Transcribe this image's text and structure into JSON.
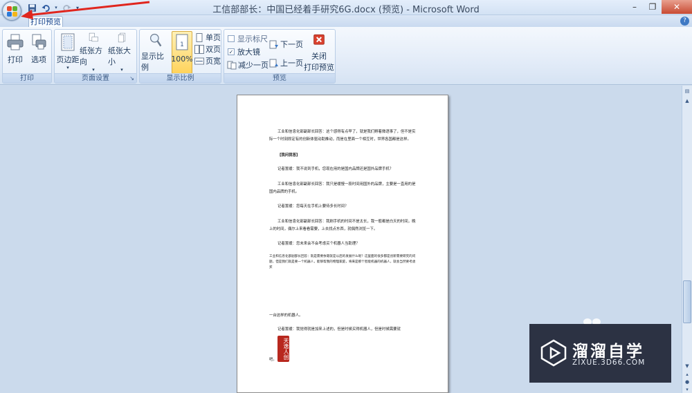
{
  "window": {
    "title": "工信部部长：中国已经着手研究6G.docx (预览) - Microsoft Word",
    "controls": {
      "minimize": "–",
      "restore": "❐",
      "close": "✕"
    }
  },
  "quick_access": {
    "save_icon": "save-icon",
    "undo_icon": "undo-icon",
    "redo_icon": "redo-icon",
    "customize": "▾"
  },
  "tabs": {
    "active_label": "打印预览"
  },
  "help": "?",
  "ribbon": {
    "groups": {
      "print": {
        "label": "打印",
        "print_label": "打印",
        "options_label": "选项"
      },
      "page_setup": {
        "label": "页面设置",
        "margins_label": "页边距",
        "orientation_label": "纸张方向",
        "size_label": "纸张大小"
      },
      "zoom": {
        "label": "显示比例",
        "zoom_label": "显示比例",
        "percent_label": "100%",
        "one_page": "单页",
        "two_pages": "双页",
        "page_width": "页宽"
      },
      "preview": {
        "label": "预览",
        "show_ruler": "显示标尺",
        "magnifier": "放大镜",
        "shrink_one_page": "减少一页",
        "next_page": "下一页",
        "prev_page": "上一页",
        "close_label_1": "关闭",
        "close_label_2": "打印预览"
      }
    }
  },
  "document": {
    "paragraphs": [
      "工业和信息化部副部长回答：这个感得有点早了，就是我们孵着微语事了，但不是实际一个时刻即定有的创新体驱动助推动，而是在里面一个相互时，世界各国都是这样。",
      "【我问我答】",
      "记者置缓：我不说到手机，您现在用的是国内品牌还是国外品牌手机？",
      "工业和信息化部副部长回答：我只是缓慢一段时间用国外的品牌，主要是一直用的是国内品牌的手机。",
      "记者置缓：您每天在手机上要待多长时间？",
      "工业和信息化部副部长回答：我刷手机的时间不是太长，我一般都是白天的时间，晚上的时间，偶尔上来看看需要，上去找点东西，就偶然浏览一下。",
      "记者置缓：您未来会不会考虑买个机器人当助理？",
      "工业和信息化部副部长回答：就是需要依靠就是以后的发展什么呢？这里面的很多都是创新需要研究的问题，但是我们就是要一个机器人，能够帮我的物理家庭，将来是那个智能机器的机器人，就会当然要考虑买",
      "一台这样的机器人。",
      "记者置缓：我觉得就是加来上述的，但是时候买得机器人，但是时候需要就",
      "吧。"
    ],
    "seal_text": "天逸人创"
  },
  "watermark": {
    "name": "溜溜自学",
    "url": "ZIXUE.3D66.COM"
  }
}
